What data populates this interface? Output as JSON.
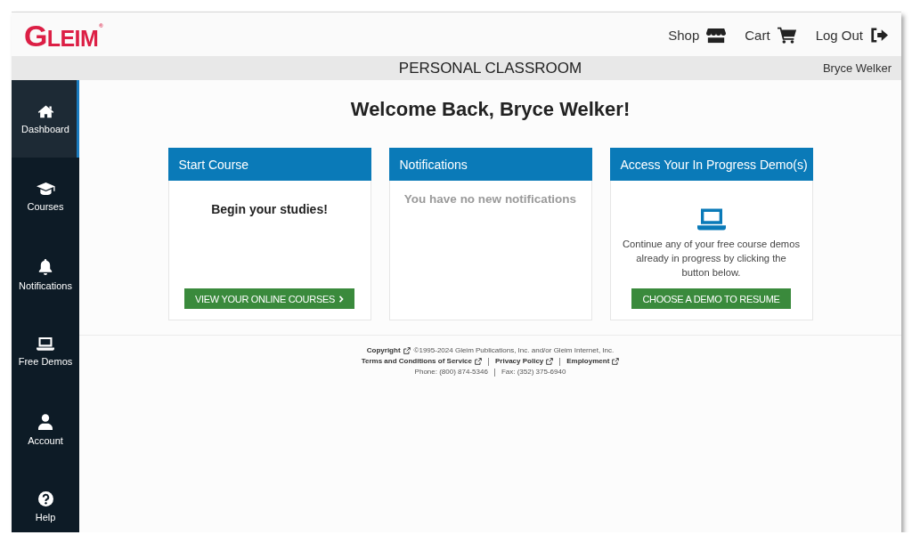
{
  "header": {
    "logo": "GLEIM$^{®}$",
    "links": [
      "Shop",
      "Cart",
      "Log Out"
    ]
  },
  "title_bar": {
    "title": "PERSONAL CLASSROOM",
    "user": "Bryce Welker"
  },
  "sidebar": {
    "items": [
      {
        "label": "Dashboard",
        "selected": true
      },
      {
        "label": "Courses",
        "selected": false
      },
      {
        "label": "Notifications",
        "selected": false
      },
      {
        "label": "Free Demos",
        "selected": false
      },
      {
        "label": "Account",
        "selected": false
      },
      {
        "label": "Help",
        "selected": false
      }
    ]
  },
  "main": {
    "welcome": "Welcome Back, Bryce Welker!",
    "cards": [
      {
        "title": "Start Course",
        "kind": "action",
        "heading": "Begin your studies!",
        "button": "VIEW YOUR ONLINE COURSES"
      },
      {
        "title": "Notifications",
        "kind": "message",
        "message": "You have no new notifications"
      },
      {
        "title": "Access Your In Progress Demo(s)",
        "kind": "demo",
        "text": "Continue any of your free course demos already in progress by clicking the button below.",
        "button": "CHOOSE A DEMO TO RESUME"
      }
    ]
  },
  "footer": {
    "copyright_link": "Copyright",
    "copyright_text": "©1995-2024 Gleim Publications, Inc. and/or Gleim Internet, Inc.",
    "links": [
      "Terms and Conditions of Service",
      "Privacy Policy",
      "Employment"
    ],
    "contacts": [
      "Phone: (800) 874-5346",
      "Fax: (352) 375-6940"
    ]
  }
}
